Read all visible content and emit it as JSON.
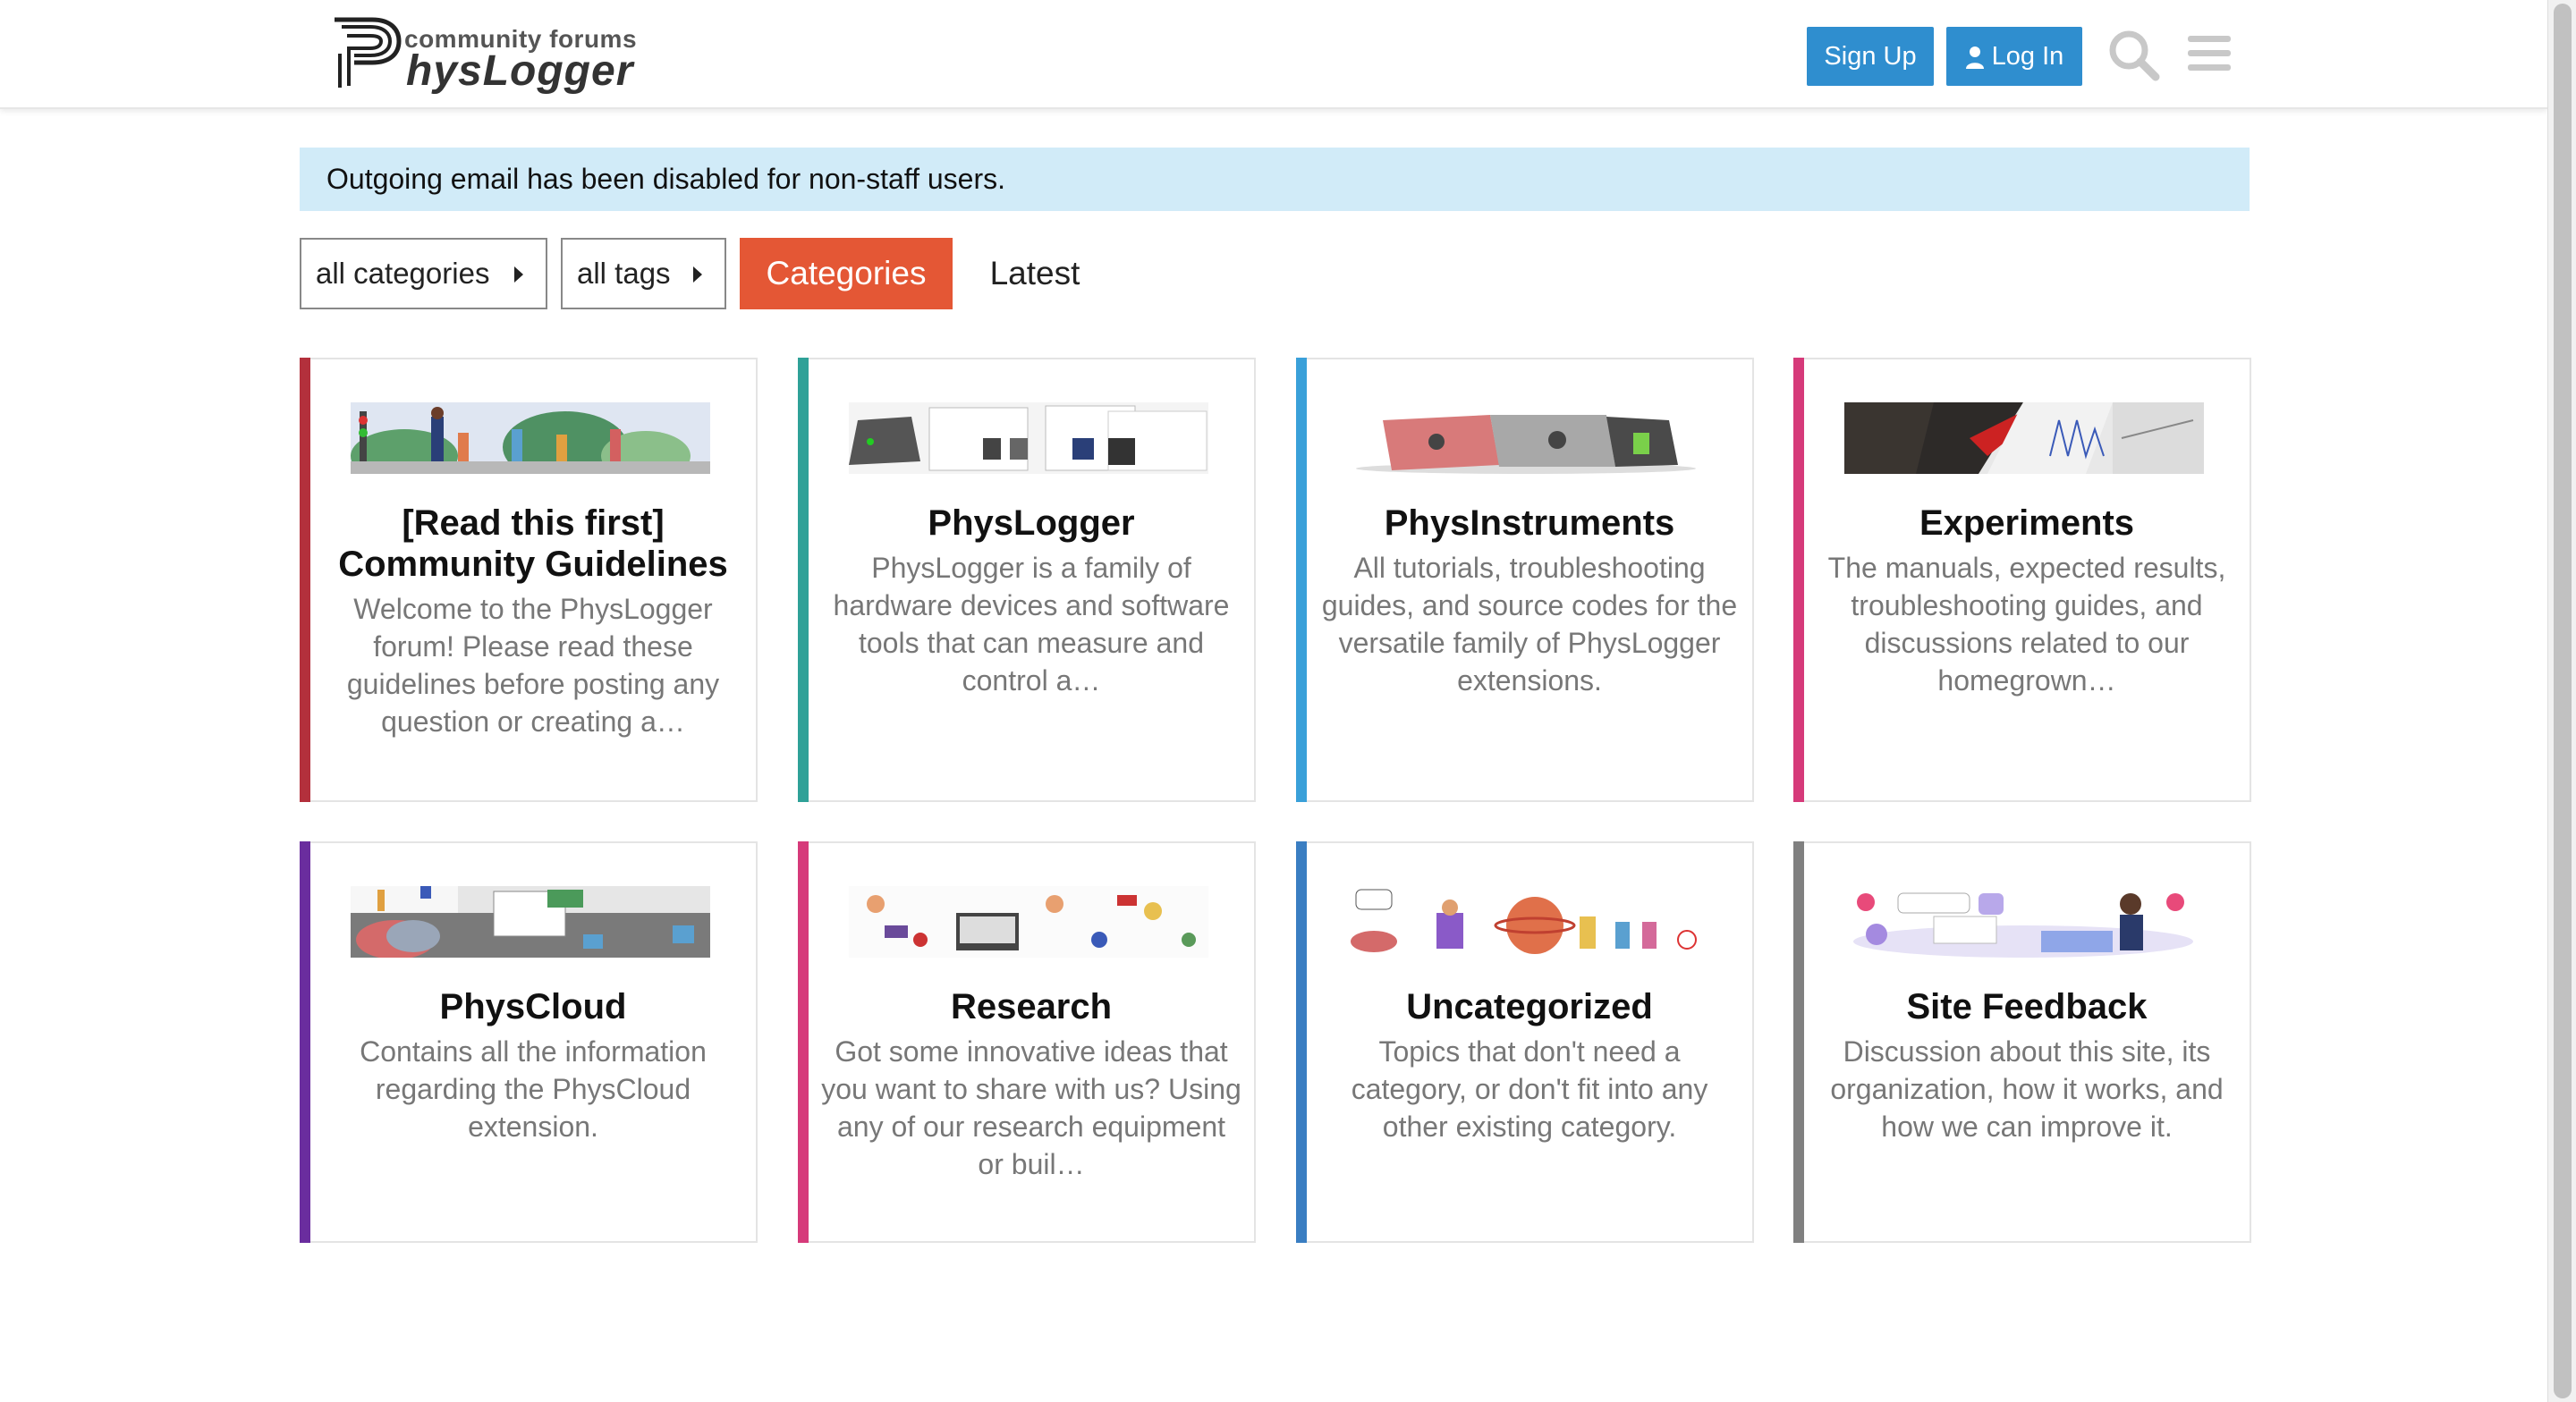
{
  "header": {
    "logo_small": "community forums",
    "logo_big": "hysLogger",
    "signup_label": "Sign Up",
    "login_label": "Log In"
  },
  "notice": "Outgoing email has been disabled for non-staff users.",
  "nav": {
    "all_categories": "all categories",
    "all_tags": "all tags",
    "tab_categories": "Categories",
    "tab_latest": "Latest"
  },
  "colors": {
    "header_button": "#2f8ecf",
    "active_tab": "#e45735",
    "notice_bg": "#d1ebf8"
  },
  "categories": [
    {
      "title": "[Read this first] Community Guidelines",
      "description": "Welcome to the PhysLogger forum! Please read these guidelines before posting any question or creating a…",
      "color": "#b3303c"
    },
    {
      "title": "PhysLogger",
      "description": "PhysLogger is a family of hardware devices and software tools that can measure and control a…",
      "color": "#2fa198"
    },
    {
      "title": "PhysInstruments",
      "description": "All tutorials, troubleshooting guides, and source codes for the versatile family of PhysLogger extensions.",
      "color": "#3aa0d9"
    },
    {
      "title": "Experiments",
      "description": "The manuals, expected results, troubleshooting guides, and discussions related to our homegrown…",
      "color": "#d63a7a"
    },
    {
      "title": "PhysCloud",
      "description": "Contains all the information regarding the PhysCloud extension.",
      "color": "#6a2d9e"
    },
    {
      "title": "Research",
      "description": "Got some innovative ideas that you want to share with us? Using any of our research equipment or buil…",
      "color": "#d63a7a"
    },
    {
      "title": "Uncategorized",
      "description": "Topics that don't need a category, or don't fit into any other existing category.",
      "color": "#3a7ec2"
    },
    {
      "title": "Site Feedback",
      "description": "Discussion about this site, its organization, how it works, and how we can improve it.",
      "color": "#808080"
    }
  ]
}
